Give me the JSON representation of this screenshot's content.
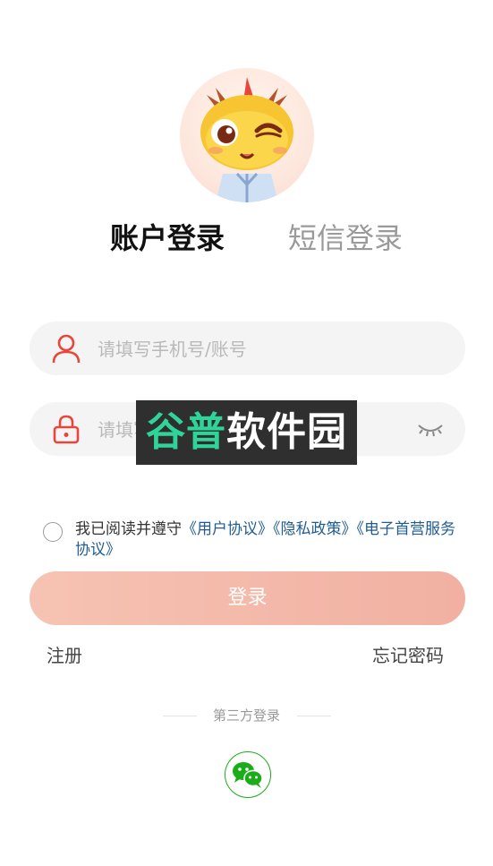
{
  "tabs": {
    "account_login": "账户登录",
    "sms_login": "短信登录"
  },
  "form": {
    "username_placeholder": "请填写手机号/账号",
    "password_placeholder": "请填写密码"
  },
  "watermark": {
    "accent": "谷普",
    "rest": "软件园"
  },
  "agreement": {
    "prefix": "我已阅读并遵守",
    "user_agreement": "《用户协议》",
    "privacy_policy": "《隐私政策》",
    "service_agreement": "《电子首营服务协议》"
  },
  "buttons": {
    "login": "登录",
    "register": "注册",
    "forgot_password": "忘记密码"
  },
  "third_party": {
    "label": "第三方登录",
    "wechat_icon": "wechat-icon"
  },
  "colors": {
    "accent_red": "#e8463a",
    "login_gradient_start": "#f6c3b2",
    "login_gradient_end": "#f1b0a2",
    "link_blue": "#1f5c93",
    "wechat_green": "#1aad19"
  }
}
